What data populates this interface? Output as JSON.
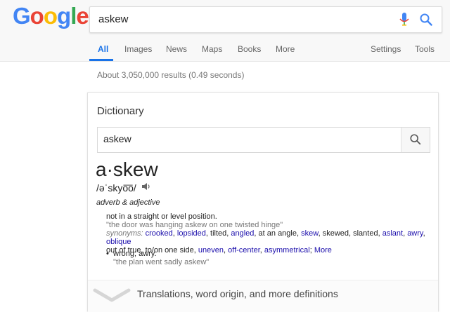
{
  "logo": {
    "letters": [
      "G",
      "o",
      "o",
      "g",
      "l",
      "e"
    ],
    "colors": [
      "#4285F4",
      "#EA4335",
      "#FBBC05",
      "#4285F4",
      "#34A853",
      "#EA4335"
    ]
  },
  "search": {
    "query": "askew"
  },
  "tabs": [
    {
      "label": "All"
    },
    {
      "label": "Images"
    },
    {
      "label": "News"
    },
    {
      "label": "Maps"
    },
    {
      "label": "Books"
    },
    {
      "label": "More"
    },
    {
      "label": "Settings"
    },
    {
      "label": "Tools"
    }
  ],
  "results": {
    "stats": "About 3,050,000 results (0.49 seconds)"
  },
  "dictionary": {
    "title": "Dictionary",
    "search_value": "askew",
    "word": "a·skew",
    "pronunciation": "/əˈskyo͞o/",
    "part_of_speech": "adverb & adjective",
    "def1": {
      "text": "not in a straight or level position.",
      "example": "\"the door was hanging askew on one twisted hinge\"",
      "synonyms_label": "synonyms:",
      "syn1": "crooked",
      "syn2": "lopsided",
      "syn3": "tilted,",
      "syn4": "angled",
      "syn5": "at an angle,",
      "syn6": "skew",
      "syn7": "skewed, slanted,",
      "syn8": "aslant",
      "syn9": "awry",
      "syn10": "oblique",
      "syn11": "out of true, to/on one side,",
      "syn12": "uneven",
      "syn13": "off-center",
      "syn14": "asymmetrical",
      "more": "More"
    },
    "def2": {
      "text": "wrong; awry.",
      "example": "\"the plan went sadly askew\""
    },
    "footer": "Translations, word origin, and more definitions"
  },
  "icons": {
    "mic": "microphone-icon",
    "search": "search-icon",
    "speaker": "speaker-icon",
    "expand": "chevron-down-icon"
  }
}
